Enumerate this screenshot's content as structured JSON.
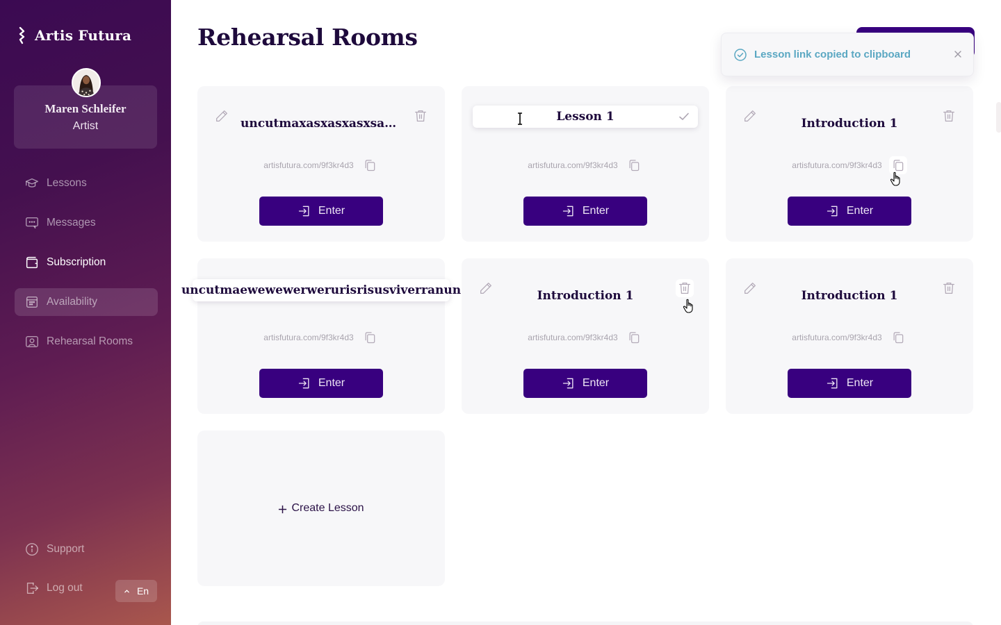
{
  "app": {
    "brand_name": "Artis Futura",
    "page_title": "Rehearsal Rooms"
  },
  "profile": {
    "name": "Maren Schleifer",
    "role": "Artist"
  },
  "sidebar": {
    "items": [
      {
        "label": "Lessons",
        "icon": "graduation-cap-icon",
        "state": "default"
      },
      {
        "label": "Messages",
        "icon": "chat-bubble-icon",
        "state": "default"
      },
      {
        "label": "Subscription",
        "icon": "wallet-icon",
        "state": "active"
      },
      {
        "label": "Availability",
        "icon": "calendar-icon",
        "state": "hover"
      },
      {
        "label": "Rehearsal Rooms",
        "icon": "user-frame-icon",
        "state": "default"
      }
    ],
    "bottom": [
      {
        "label": "Support",
        "icon": "info-icon"
      },
      {
        "label": "Log out",
        "icon": "logout-icon"
      }
    ],
    "language": {
      "label": "En",
      "icon": "chevron-up-icon"
    }
  },
  "toast": {
    "message": "Lesson link copied to clipboard",
    "icon": "check-circle-icon",
    "color": "#5aa7c2"
  },
  "lessons": [
    {
      "title": "uncutmaxasxasxasxsaurisrisusviverranun",
      "display_title": "uncutmaxasxasxasxsauris...",
      "link": "artisfutura.com/9f3kr4d3",
      "enter_label": "Enter",
      "mode": "view"
    },
    {
      "title": "Lesson 1",
      "link": "artisfutura.com/9f3kr4d3",
      "enter_label": "Enter",
      "mode": "editing"
    },
    {
      "title": "Introduction 1",
      "link": "artisfutura.com/9f3kr4d3",
      "enter_label": "Enter",
      "mode": "view",
      "hover": "copy"
    },
    {
      "title": "uncutmaewewewerweruris risusviverranun",
      "display_title": "uncutmaewewewerwerurisrisusviverranun",
      "link": "artisfutura.com/9f3kr4d3",
      "enter_label": "Enter",
      "mode": "editing-wide"
    },
    {
      "title": "Introduction 1",
      "link": "artisfutura.com/9f3kr4d3",
      "enter_label": "Enter",
      "mode": "view",
      "hover": "delete"
    },
    {
      "title": "Introduction 1",
      "link": "artisfutura.com/9f3kr4d3",
      "enter_label": "Enter",
      "mode": "view"
    }
  ],
  "create_lesson": {
    "label": "Create Lesson",
    "icon": "plus-icon"
  },
  "colors": {
    "primary": "#38007f",
    "heading": "#1e0a3c",
    "card_bg": "#f7f7f9",
    "muted_text": "#a9a4ae"
  }
}
